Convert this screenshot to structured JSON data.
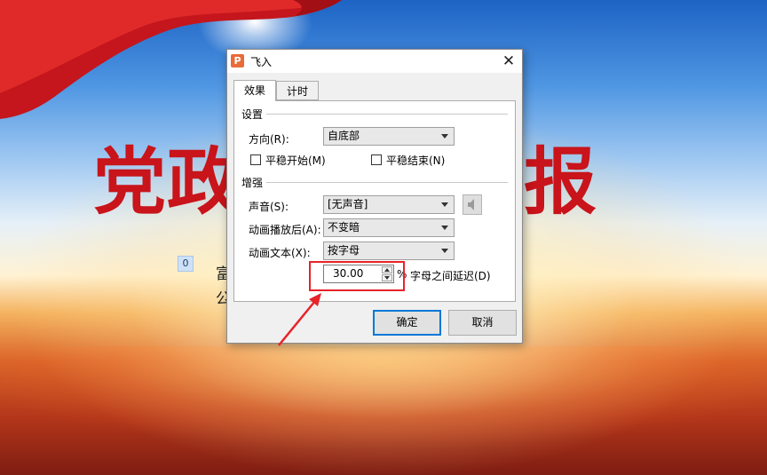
{
  "slide": {
    "title_chars": [
      "党",
      "政",
      "报"
    ],
    "badge": "0",
    "body_chars": [
      "富",
      "公"
    ]
  },
  "dialog": {
    "icon_letter": "P",
    "title": "飞入",
    "tabs": [
      {
        "label": "效果",
        "active": true
      },
      {
        "label": "计时",
        "active": false
      }
    ],
    "settings": {
      "section": "设置",
      "direction_label": "方向(R):",
      "direction_value": "自底部",
      "smooth_start_label": "平稳开始(M)",
      "smooth_end_label": "平稳结束(N)"
    },
    "enhance": {
      "section": "增强",
      "sound_label": "声音(S):",
      "sound_value": "[无声音]",
      "after_label": "动画播放后(A):",
      "after_value": "不变暗",
      "text_label": "动画文本(X):",
      "text_value": "按字母",
      "delay_value": "30.00",
      "delay_unit": "%",
      "delay_label": "字母之间延迟(D)"
    },
    "ok_label": "确定",
    "cancel_label": "取消"
  },
  "colors": {
    "highlight": "#e8232a",
    "title_red": "#c8141a",
    "default_button_border": "#0078d7"
  }
}
